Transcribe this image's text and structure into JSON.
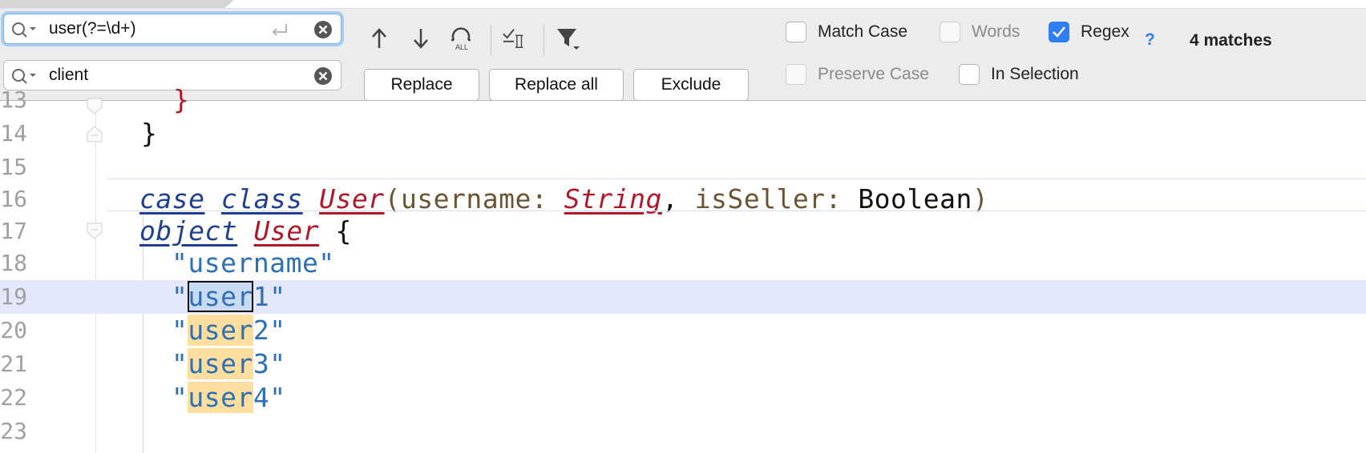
{
  "find": {
    "search_value": "user(?=\\d+)",
    "replace_value": "client"
  },
  "buttons": {
    "replace": "Replace",
    "replace_all": "Replace all",
    "exclude": "Exclude"
  },
  "options": {
    "match_case": {
      "label": "Match Case",
      "checked": false
    },
    "words": {
      "label": "Words",
      "checked": false,
      "disabled": true
    },
    "regex": {
      "label": "Regex",
      "checked": true
    },
    "help": "?",
    "preserve_case": {
      "label": "Preserve Case",
      "checked": false,
      "disabled": true
    },
    "in_selection": {
      "label": "In Selection",
      "checked": false
    }
  },
  "match_count": "4 matches",
  "editor": {
    "line_numbers": [
      "13",
      "14",
      "15",
      "16",
      "17",
      "18",
      "19",
      "20",
      "21",
      "22",
      "23"
    ],
    "lines": {
      "l14": "}",
      "l16": {
        "kw1": "case",
        "kw2": "class",
        "cls": "User",
        "open": "(",
        "p1": "username",
        "colon1": ": ",
        "type1": "String",
        "comma": ", ",
        "p2": "isSeller",
        "colon2": ": ",
        "type2": "Boolean",
        "close": ")"
      },
      "l17": {
        "kw": "object",
        "cls": "User",
        "brace": "{"
      },
      "l18": "\"username\"",
      "l19": {
        "q1": "\"",
        "match": "user",
        "rest": "1\""
      },
      "l20": {
        "q1": "\"",
        "match": "user",
        "rest": "2\""
      },
      "l21": {
        "q1": "\"",
        "match": "user",
        "rest": "3\""
      },
      "l22": {
        "q1": "\"",
        "match": "user",
        "rest": "4\""
      }
    }
  },
  "colors": {
    "accent": "#2f7ff0",
    "match_highlight": "#ffde9e",
    "current_line": "#e4e6fb",
    "keyword": "#1f3f8f",
    "class_name": "#b0182a",
    "string": "#2f6fb4"
  }
}
